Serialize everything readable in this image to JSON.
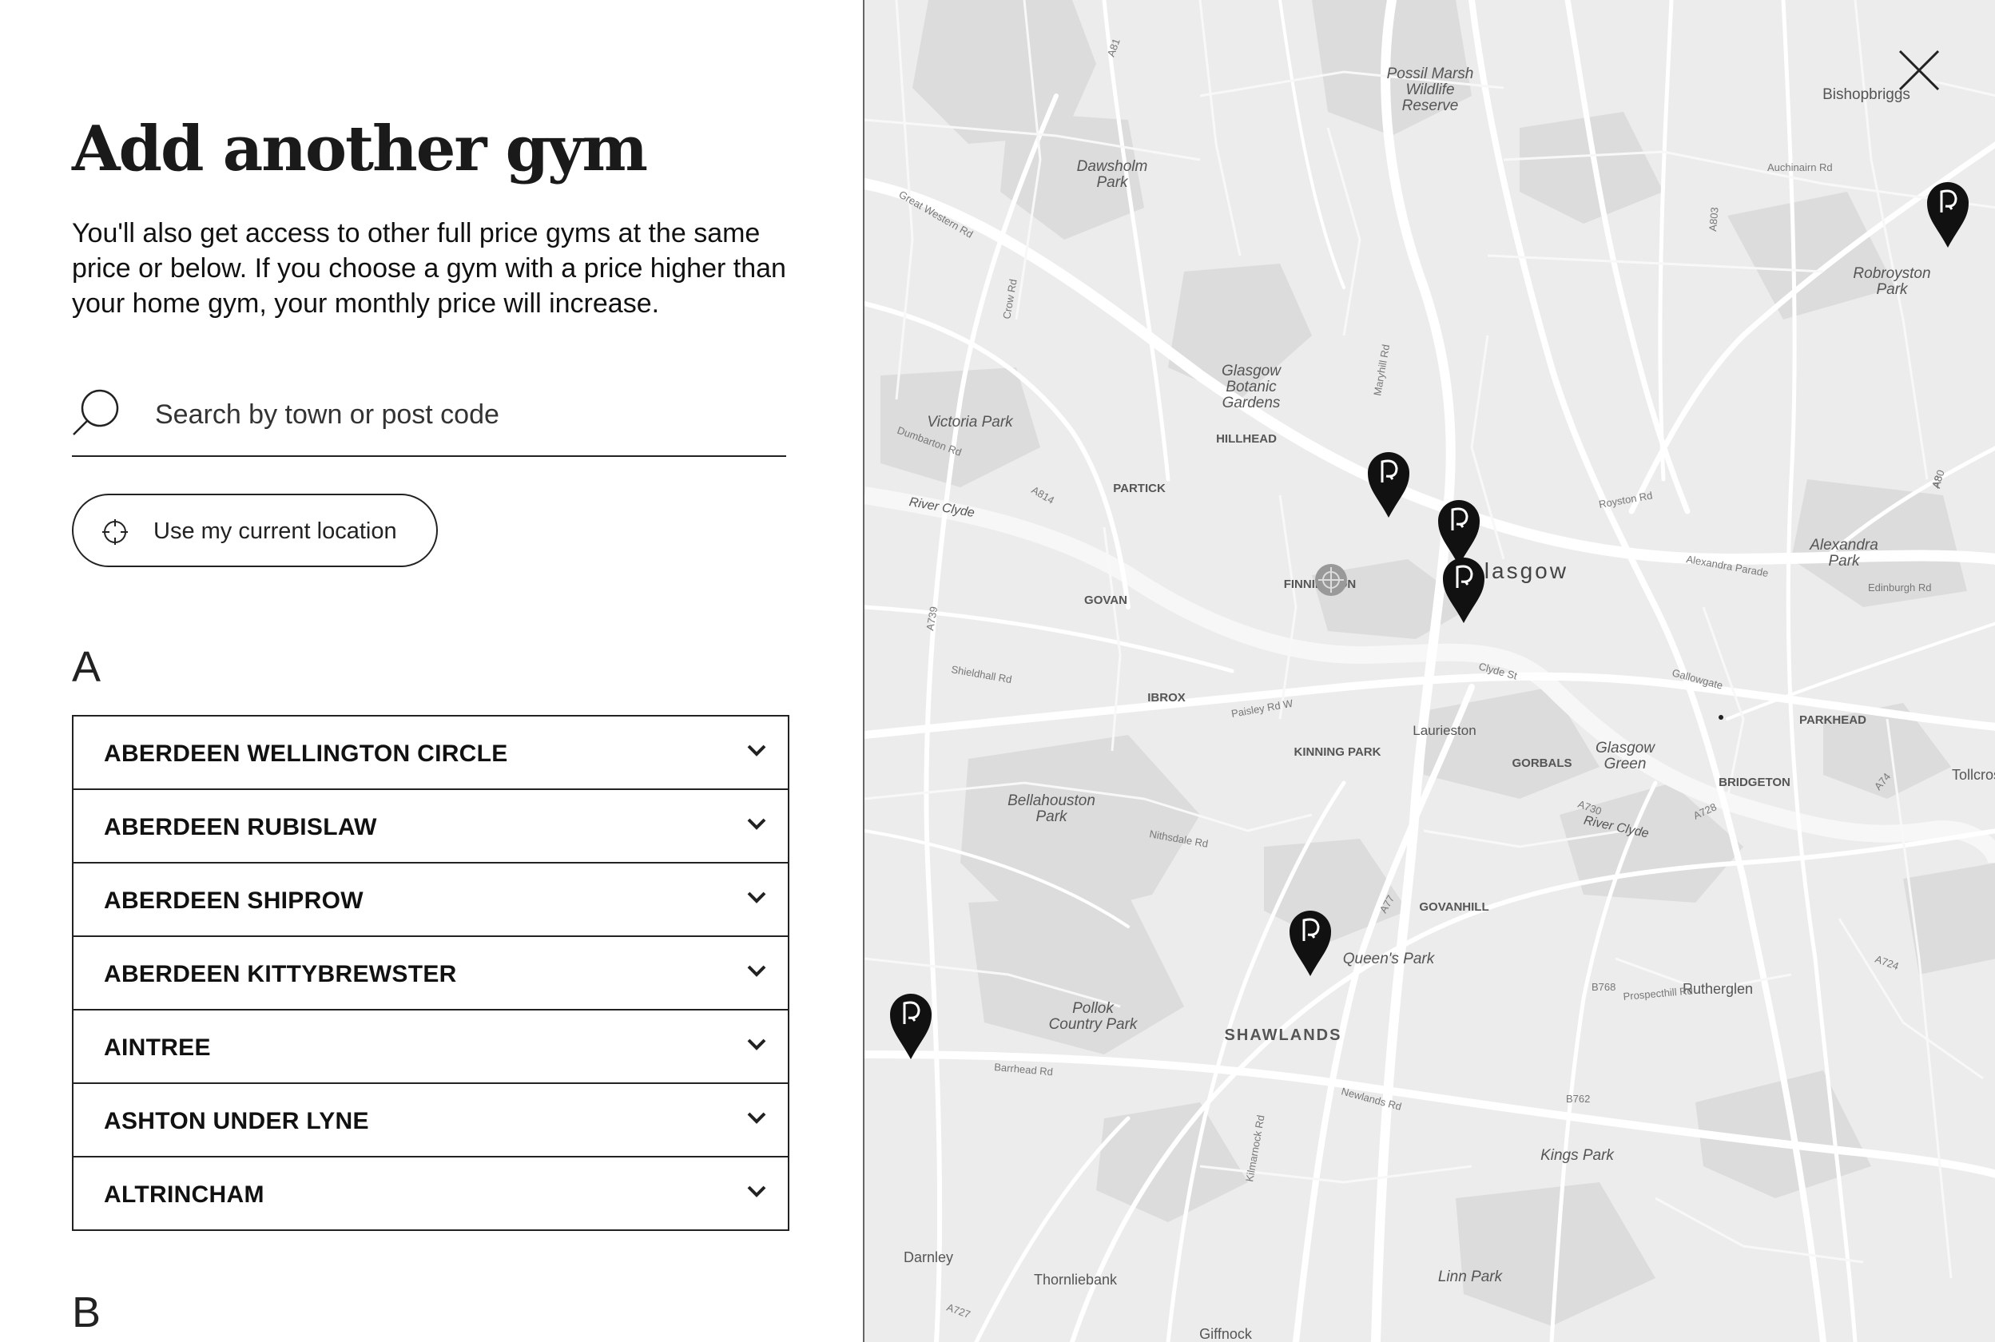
{
  "panel": {
    "title": "Add another gym",
    "description": "You'll also get access to other full price gyms at the same price or below. If you choose a gym with a price higher than your home gym, your monthly price will increase.",
    "search_placeholder": "Search by town or post code",
    "location_button": "Use my current location"
  },
  "groups": [
    {
      "letter": "A",
      "gyms": [
        "ABERDEEN WELLINGTON CIRCLE",
        "ABERDEEN RUBISLAW",
        "ABERDEEN SHIPROW",
        "ABERDEEN KITTYBREWSTER",
        "AINTREE",
        "ASHTON UNDER LYNE",
        "ALTRINCHAM"
      ]
    },
    {
      "letter": "B",
      "gyms": []
    }
  ],
  "map": {
    "labels": {
      "l1": "Possil Marsh",
      "l2": "Wildlife",
      "l3": "Reserve",
      "l4": "Bishopbriggs",
      "l5": "Dawsholm",
      "l6": "Park",
      "l7": "Robroyston",
      "l8": "Park",
      "l9": "Glasgow",
      "l10": "Botanic",
      "l11": "Gardens",
      "l12": "Victoria Park",
      "l13": "HILLHEAD",
      "l14": "PARTICK",
      "l15": "River Clyde",
      "l16": "Glasgow",
      "l17": "FINNIESTON",
      "l18": "GOVAN",
      "l19": "Alexandra",
      "l20": "Park",
      "l21": "IBROX",
      "l22": "Laurieston",
      "l23": "KINNING PARK",
      "l24": "GORBALS",
      "l25": "Glasgow",
      "l26": "Green",
      "l27": "PARKHEAD",
      "l28": "BRIDGETON",
      "l29": "Bellahouston",
      "l30": "Park",
      "l31": "River Clyde",
      "l32": "GOVANHILL",
      "l33": "Queen's Park",
      "l34": "Rutherglen",
      "l35": "Pollok",
      "l36": "Country Park",
      "l37": "SHAWLANDS",
      "l38": "Kings Park",
      "l39": "Darnley",
      "l40": "Thornliebank",
      "l41": "Linn Park",
      "l42": "Giffnock",
      "l43": "Tollcross"
    },
    "roads": {
      "r1": "A81",
      "r2": "A803",
      "r3": "Auchinairn Rd",
      "r4": "A814",
      "r5": "A8",
      "r6": "A739",
      "r7": "A730",
      "r8": "A728",
      "r9": "A724",
      "r10": "A77",
      "r11": "B768",
      "r12": "B762",
      "r13": "A74",
      "r14": "Paisley Rd W",
      "r15": "Great Western Rd",
      "r16": "Maryhill Rd",
      "r17": "Clyde St",
      "r18": "Edinburgh Rd",
      "r19": "Gallowgate",
      "r20": "Nithsdale Rd",
      "r21": "Barrhead Rd",
      "r22": "Kilmarnock Rd",
      "r23": "Newlands Rd",
      "r24": "Royston Rd",
      "r25": "Crow Rd",
      "r26": "Dumbarton Rd",
      "r27": "Shieldhall Rd",
      "r28": "Alexandra Parade",
      "r29": "A80",
      "r30": "Prospecthill Rd",
      "r31": "A727"
    }
  }
}
